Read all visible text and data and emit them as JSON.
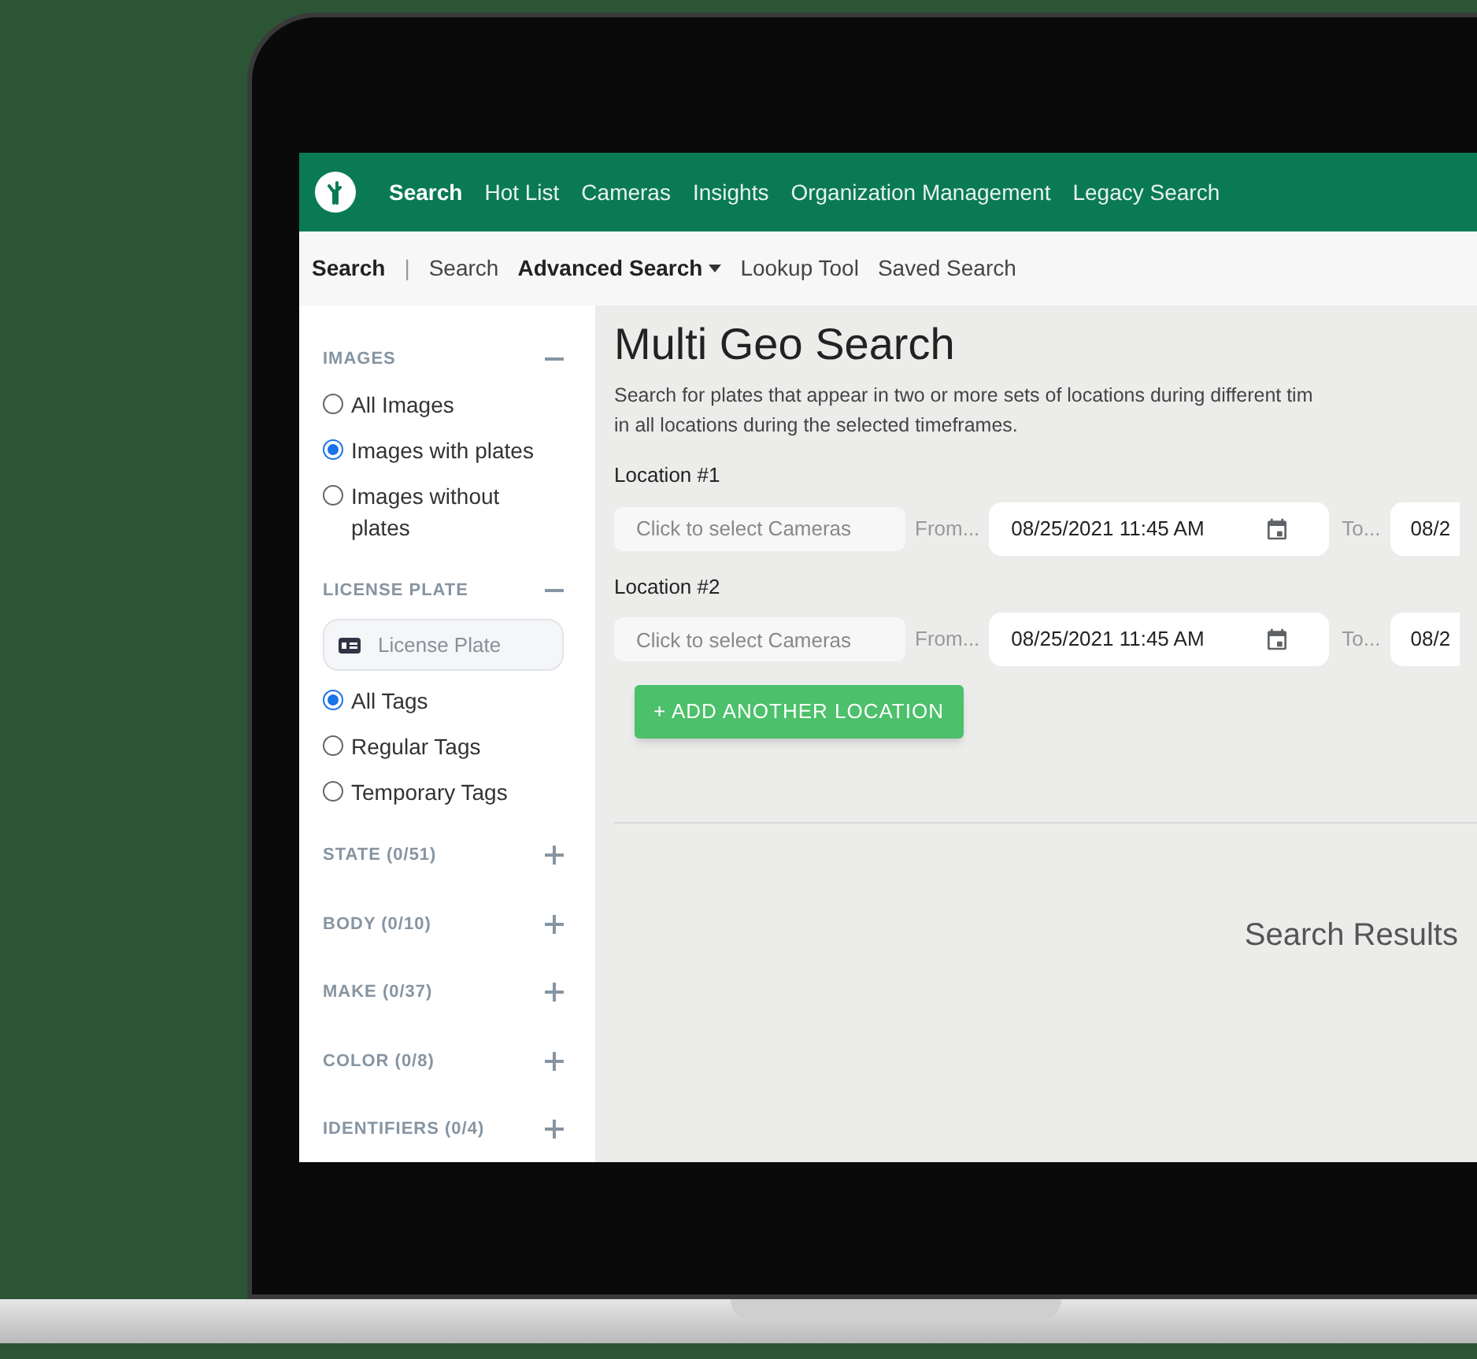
{
  "nav": {
    "items": [
      {
        "label": "Search",
        "selected": true
      },
      {
        "label": "Hot List",
        "selected": false
      },
      {
        "label": "Cameras",
        "selected": false
      },
      {
        "label": "Insights",
        "selected": false
      },
      {
        "label": "Organization Management",
        "selected": false
      },
      {
        "label": "Legacy Search",
        "selected": false
      }
    ]
  },
  "subnav": {
    "title": "Search",
    "separator": "|",
    "items": [
      {
        "label": "Search",
        "selected": false,
        "dropdown": false
      },
      {
        "label": "Advanced Search",
        "selected": true,
        "dropdown": true
      },
      {
        "label": "Lookup Tool",
        "selected": false,
        "dropdown": false
      },
      {
        "label": "Saved Search",
        "selected": false,
        "dropdown": false
      }
    ]
  },
  "sidebar": {
    "sections": [
      {
        "title": "IMAGES",
        "expanded": true,
        "options": [
          {
            "label": "All Images",
            "selected": false
          },
          {
            "label": "Images with plates",
            "selected": true
          },
          {
            "label": "Images without plates",
            "selected": false
          }
        ]
      },
      {
        "title": "LICENSE PLATE",
        "expanded": true,
        "placeholder": "License Plate",
        "options": [
          {
            "label": "All Tags",
            "selected": true
          },
          {
            "label": "Regular Tags",
            "selected": false
          },
          {
            "label": "Temporary Tags",
            "selected": false
          }
        ]
      },
      {
        "title": "STATE (0/51)",
        "expanded": false
      },
      {
        "title": "BODY (0/10)",
        "expanded": false
      },
      {
        "title": "MAKE (0/37)",
        "expanded": false
      },
      {
        "title": "COLOR (0/8)",
        "expanded": false
      },
      {
        "title": "IDENTIFIERS (0/4)",
        "expanded": false
      }
    ]
  },
  "main": {
    "title": "Multi Geo Search",
    "description": "Search for plates that appear in two or more sets of locations during different tim",
    "description_2": "in all locations during the selected timeframes.",
    "locations": [
      {
        "label": "Location #1",
        "cameras_placeholder": "Click to select Cameras",
        "from_placeholder": "From...",
        "from_value": "08/25/2021 11:45 AM",
        "to_placeholder": "To...",
        "to_value": "08/2"
      },
      {
        "label": "Location #2",
        "cameras_placeholder": "Click to select Cameras",
        "from_placeholder": "From...",
        "from_value": "08/25/2021 11:45 AM",
        "to_placeholder": "To...",
        "to_value": "08/2"
      }
    ],
    "add_button": "+ ADD ANOTHER LOCATION",
    "results_title": "Search Results"
  }
}
